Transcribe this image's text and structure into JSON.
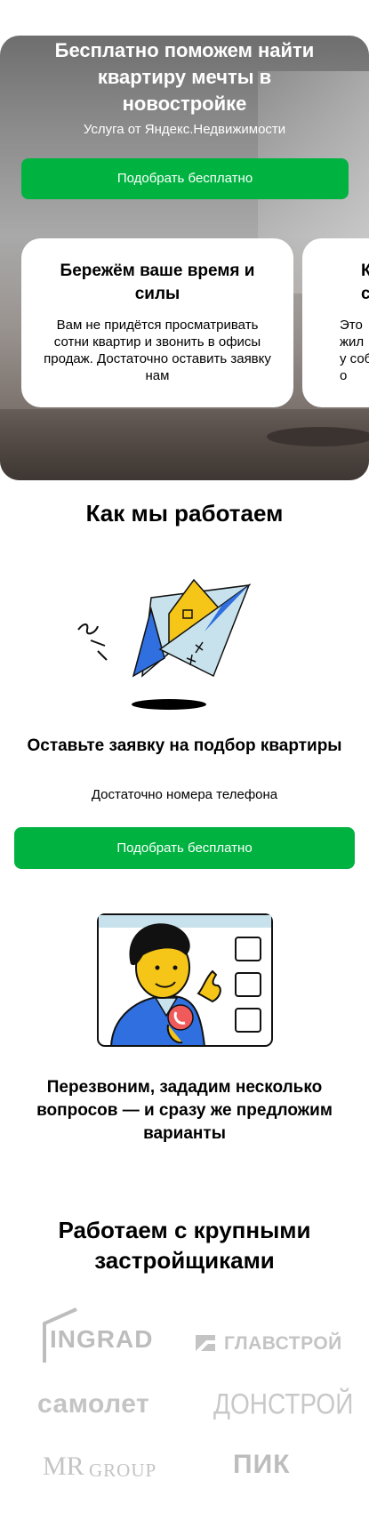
{
  "hero": {
    "title": "Бесплатно поможем найти квартиру мечты в новостройке",
    "subtitle": "Услуга от Яндекс.Недвижимости",
    "cta_label": "Подобрать бесплатно"
  },
  "cards": [
    {
      "title": "Бережём ваше время и силы",
      "text": "Вам не придётся просматривать сотни квартир и звонить в офисы продаж. Достаточно оставить заявку нам"
    },
    {
      "title": "К\nс",
      "text": "Это\nжил\nу собе\nо"
    }
  ],
  "how_it_works": {
    "title": "Как мы работаем",
    "steps": [
      {
        "title": "Оставьте заявку на подбор квартиры",
        "subtitle": "Достаточно номера телефона",
        "cta_label": "Подобрать бесплатно",
        "icon": "paper-plane-house-icon"
      },
      {
        "title": "Перезвоним, зададим несколько вопросов — и сразу же предложим варианты",
        "icon": "operator-call-icon"
      }
    ]
  },
  "partners": {
    "title": "Работаем с крупными застройщиками",
    "logos": {
      "ingrad": "INGRAD",
      "glavstroy": "ГЛАВСТРОЙ",
      "samolet": "самолет",
      "donstroy": "ДОНСТРОЙ",
      "mr_mark": "MR",
      "mr_group": "GROUP",
      "pik": "ПИК"
    }
  },
  "colors": {
    "accent_green": "#00b341",
    "logo_gray": "#c4c4c4",
    "illustration_yellow": "#f5c518",
    "illustration_blue": "#2f6fe0",
    "illustration_lightblue": "#c7e2ec",
    "illustration_red": "#f05a5a"
  }
}
